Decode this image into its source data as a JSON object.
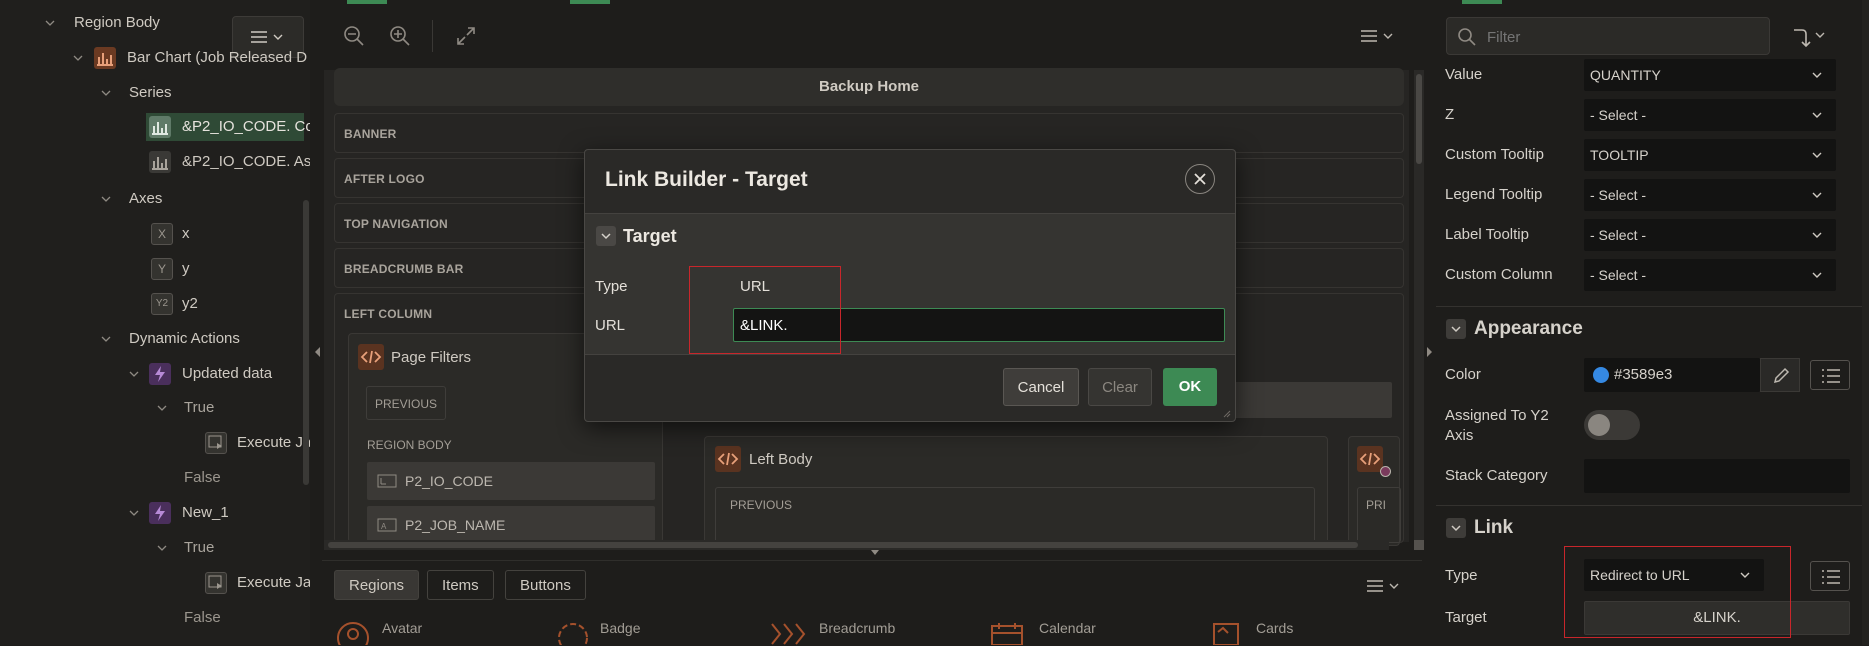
{
  "tree": {
    "items": [
      {
        "label": "Region Body"
      },
      {
        "label": "Bar Chart (Job Released D"
      },
      {
        "label": "Series"
      },
      {
        "label": "&P2_IO_CODE. Co"
      },
      {
        "label": "&P2_IO_CODE. As"
      },
      {
        "label": "Axes"
      },
      {
        "label": "x"
      },
      {
        "label": "y"
      },
      {
        "label": "y2"
      },
      {
        "label": "Dynamic Actions"
      },
      {
        "label": "Updated data"
      },
      {
        "label": "True"
      },
      {
        "label": "Execute Ja"
      },
      {
        "label": "False"
      },
      {
        "label": "New_1"
      },
      {
        "label": "True"
      },
      {
        "label": "Execute Ja"
      },
      {
        "label": "False"
      }
    ],
    "axis_icons": {
      "x": "X",
      "y": "Y",
      "y2": "Y2"
    }
  },
  "canvas": {
    "page_title": "Backup Home",
    "positions": [
      "BANNER",
      "AFTER LOGO",
      "TOP NAVIGATION",
      "BREADCRUMB BAR",
      "LEFT COLUMN"
    ],
    "page_filters": {
      "title": "Page Filters",
      "previous": "PREVIOUS",
      "region_body": "REGION BODY",
      "items": [
        "P2_IO_CODE",
        "P2_JOB_NAME"
      ]
    },
    "left_body": {
      "title": "Left Body",
      "previous": "PREVIOUS"
    },
    "right_stub": {
      "previous": "PRI"
    }
  },
  "gallery": {
    "tabs": [
      "Regions",
      "Items",
      "Buttons"
    ],
    "active_tab": "Regions",
    "items": [
      "Avatar",
      "Badge",
      "Breadcrumb",
      "Calendar",
      "Cards"
    ]
  },
  "dialog": {
    "title": "Link Builder - Target",
    "section": "Target",
    "type_label": "Type",
    "type_value": "URL",
    "url_label": "URL",
    "url_value": "&LINK.",
    "buttons": {
      "cancel": "Cancel",
      "clear": "Clear",
      "ok": "OK"
    }
  },
  "properties": {
    "filter_placeholder": "Filter",
    "rows": [
      {
        "label": "Value",
        "value": "QUANTITY"
      },
      {
        "label": "Z",
        "value": "- Select -"
      },
      {
        "label": "Custom Tooltip",
        "value": "TOOLTIP"
      },
      {
        "label": "Legend Tooltip",
        "value": "- Select -"
      },
      {
        "label": "Label Tooltip",
        "value": "- Select -"
      },
      {
        "label": "Custom Column",
        "value": "- Select -"
      }
    ],
    "appearance": {
      "title": "Appearance",
      "color_label": "Color",
      "color_value": "#3589e3",
      "color_hex": "#3589e3",
      "assigned_label_1": "Assigned To Y2",
      "assigned_label_2": "Axis",
      "stack_label": "Stack Category"
    },
    "link": {
      "title": "Link",
      "type_label": "Type",
      "type_value": "Redirect to URL",
      "target_label": "Target",
      "target_value": "&LINK."
    }
  },
  "colors": {
    "accent_green": "#3d8a54",
    "highlight_red": "#c8262b",
    "series_color": "#3589e3"
  }
}
